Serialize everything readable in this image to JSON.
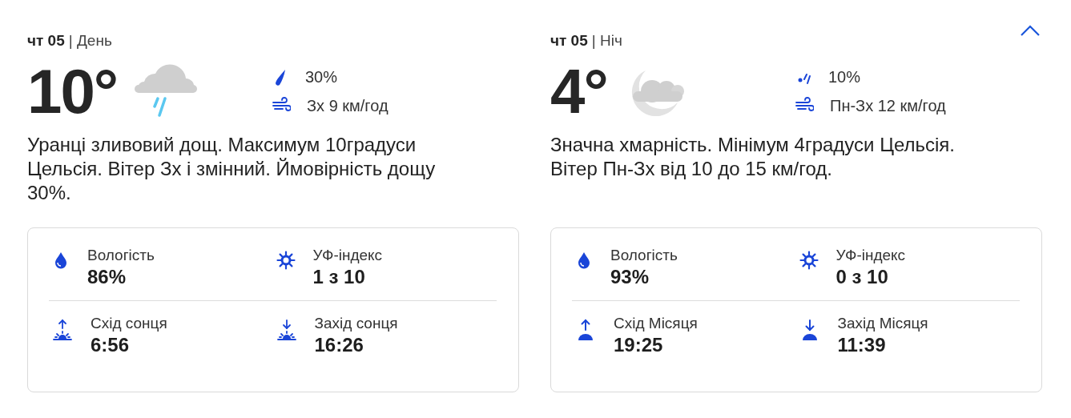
{
  "collapse_button": {
    "expanded": true
  },
  "panels": [
    {
      "day": "чт 05",
      "period": "| День",
      "temperature": "10°",
      "condition_icon": {
        "kind": "rain"
      },
      "precip_icon": {
        "kind": "rain"
      },
      "precipitation": "30%",
      "wind": "Зх 9 км/год",
      "description": "Уранці зливовий дощ. Максимум 10градуси Цельсія. Вітер Зх і змінний. Ймовірність дощу 30%.",
      "details": [
        {
          "kind": "humidity",
          "label": "Вологість",
          "value": "86%"
        },
        {
          "kind": "uv",
          "label": "УФ-індекс",
          "value": "1 з 10"
        },
        {
          "kind": "sunrise",
          "label": "Схід сонця",
          "value": "6:56"
        },
        {
          "kind": "sunset",
          "label": "Захід сонця",
          "value": "16:26"
        }
      ]
    },
    {
      "day": "чт 05",
      "period": "| Ніч",
      "temperature": "4°",
      "condition_icon": {
        "kind": "night_cloudy"
      },
      "precip_icon": {
        "kind": "drizzle"
      },
      "precipitation": "10%",
      "wind": "Пн-Зх 12 км/год",
      "description": "Значна хмарність. Мінімум 4градуси Цельсія. Вітер Пн-Зх від 10 до 15 км/год.",
      "details": [
        {
          "kind": "humidity",
          "label": "Вологість",
          "value": "93%"
        },
        {
          "kind": "uv",
          "label": "УФ-індекс",
          "value": "0 з 10"
        },
        {
          "kind": "moonrise",
          "label": "Схід Місяця",
          "value": "19:25"
        },
        {
          "kind": "moonset",
          "label": "Захід Місяця",
          "value": "11:39"
        }
      ]
    }
  ]
}
